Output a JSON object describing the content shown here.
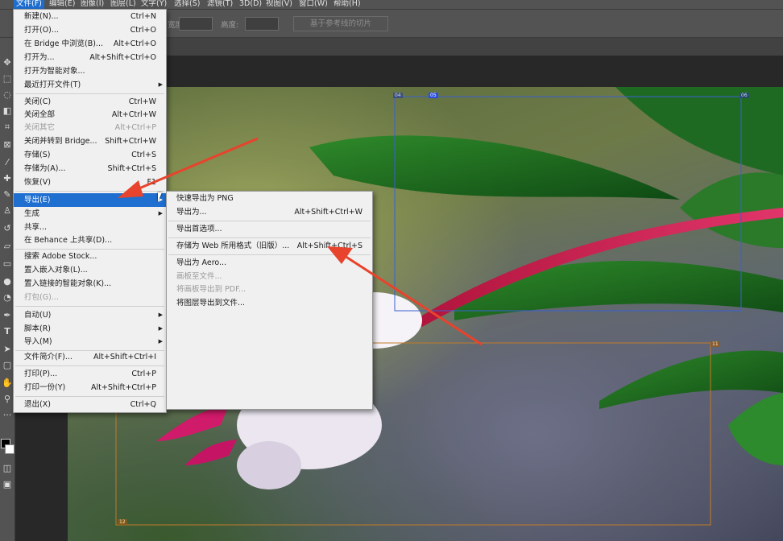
{
  "menubar": {
    "items": [
      "文件(F)",
      "编辑(E)",
      "图像(I)",
      "图层(L)",
      "文字(Y)",
      "选择(S)",
      "滤镜(T)",
      "3D(D)",
      "视图(V)",
      "窗口(W)",
      "帮助(H)"
    ],
    "active_index": 0
  },
  "options_bar": {
    "width_label": "宽度:",
    "height_label": "高度:",
    "slices_button": "基于参考线的切片"
  },
  "file_menu": {
    "new": {
      "label": "新建(N)...",
      "shortcut": "Ctrl+N"
    },
    "open": {
      "label": "打开(O)...",
      "shortcut": "Ctrl+O"
    },
    "browse_bridge": {
      "label": "在 Bridge 中浏览(B)...",
      "shortcut": "Alt+Ctrl+O"
    },
    "open_as": {
      "label": "打开为...",
      "shortcut": "Alt+Shift+Ctrl+O"
    },
    "open_smart": {
      "label": "打开为智能对象...",
      "shortcut": ""
    },
    "recent": {
      "label": "最近打开文件(T)",
      "shortcut": ""
    },
    "close": {
      "label": "关闭(C)",
      "shortcut": "Ctrl+W"
    },
    "close_all": {
      "label": "关闭全部",
      "shortcut": "Alt+Ctrl+W"
    },
    "close_others": {
      "label": "关闭其它",
      "shortcut": "Alt+Ctrl+P"
    },
    "close_go_bridge": {
      "label": "关闭并转到 Bridge...",
      "shortcut": "Shift+Ctrl+W"
    },
    "save": {
      "label": "存储(S)",
      "shortcut": "Ctrl+S"
    },
    "save_as": {
      "label": "存储为(A)...",
      "shortcut": "Shift+Ctrl+S"
    },
    "revert": {
      "label": "恢复(V)",
      "shortcut": "F1"
    },
    "export": {
      "label": "导出(E)",
      "shortcut": ""
    },
    "generate": {
      "label": "生成",
      "shortcut": ""
    },
    "share": {
      "label": "共享...",
      "shortcut": ""
    },
    "share_behance": {
      "label": "在 Behance 上共享(D)...",
      "shortcut": ""
    },
    "search_stock": {
      "label": "搜索 Adobe Stock...",
      "shortcut": ""
    },
    "place_embedded": {
      "label": "置入嵌入对象(L)...",
      "shortcut": ""
    },
    "place_linked": {
      "label": "置入链接的智能对象(K)...",
      "shortcut": ""
    },
    "package": {
      "label": "打包(G)...",
      "shortcut": ""
    },
    "automate": {
      "label": "自动(U)",
      "shortcut": ""
    },
    "scripts": {
      "label": "脚本(R)",
      "shortcut": ""
    },
    "import": {
      "label": "导入(M)",
      "shortcut": ""
    },
    "file_info": {
      "label": "文件简介(F)...",
      "shortcut": "Alt+Shift+Ctrl+I"
    },
    "print": {
      "label": "打印(P)...",
      "shortcut": "Ctrl+P"
    },
    "print_one": {
      "label": "打印一份(Y)",
      "shortcut": "Alt+Shift+Ctrl+P"
    },
    "exit": {
      "label": "退出(X)",
      "shortcut": "Ctrl+Q"
    }
  },
  "export_submenu": {
    "quick_png": {
      "label": "快速导出为 PNG",
      "shortcut": ""
    },
    "export_as": {
      "label": "导出为...",
      "shortcut": "Alt+Shift+Ctrl+W"
    },
    "prefs": {
      "label": "导出首选项...",
      "shortcut": ""
    },
    "save_web": {
      "label": "存储为 Web 所用格式（旧版）...",
      "shortcut": "Alt+Shift+Ctrl+S"
    },
    "aero": {
      "label": "导出为 Aero...",
      "shortcut": ""
    },
    "artboards_files": {
      "label": "画板至文件...",
      "shortcut": ""
    },
    "artboards_pdf": {
      "label": "将画板导出到 PDF...",
      "shortcut": ""
    },
    "layers_files": {
      "label": "将图层导出到文件...",
      "shortcut": ""
    }
  },
  "slices": {
    "tag_top_left": "04",
    "tag_top_mid": "05",
    "tag_top_right": "06",
    "tag_mid_right": "11",
    "tag_bottom_left": "12"
  },
  "colors": {
    "accent": "#1f6fd1",
    "arrow": "#e8432c",
    "menu_bg": "#f0f0f0",
    "ui_dark": "#535353"
  },
  "icons": [
    "move-icon",
    "marquee-icon",
    "lasso-icon",
    "quick-select-icon",
    "crop-icon",
    "frame-icon",
    "eyedropper-icon",
    "healing-icon",
    "brush-icon",
    "stamp-icon",
    "history-brush-icon",
    "eraser-icon",
    "gradient-icon",
    "blur-icon",
    "dodge-icon",
    "pen-icon",
    "type-icon",
    "path-select-icon",
    "rectangle-icon",
    "hand-icon",
    "zoom-icon",
    "more-icon"
  ]
}
